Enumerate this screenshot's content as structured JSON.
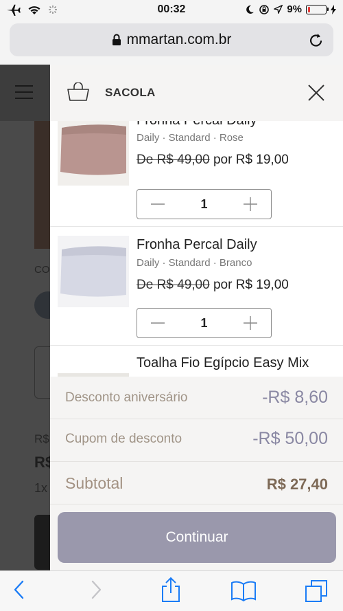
{
  "status_bar": {
    "time": "00:32",
    "battery": "9%",
    "battery_level": 0.09,
    "icons": [
      "airplane-icon",
      "wifi-icon",
      "activity-icon",
      "moon-icon",
      "rotation-lock-icon",
      "location-icon",
      "battery-icon",
      "charging-icon"
    ]
  },
  "browser": {
    "url": "mmartan.com.br",
    "icons": [
      "lock-icon",
      "reload-icon"
    ]
  },
  "background_page": {
    "partial_texts": [
      "CO",
      "R$",
      "R$",
      "1x"
    ]
  },
  "cart": {
    "title": "SACOLA",
    "items": [
      {
        "name": "Fronha Percal Daily",
        "variant": "Daily · Standard · Rose",
        "old_price": "De R$ 49,00",
        "new_price": "por R$ 19,00",
        "quantity": "1",
        "thumb_color": "#b99590"
      },
      {
        "name": "Fronha Percal Daily",
        "variant": "Daily · Standard · Branco",
        "old_price": "De R$ 49,00",
        "new_price": "por R$ 19,00",
        "quantity": "1",
        "thumb_color": "#d6d8e4"
      },
      {
        "name": "Toalha Fio Egípcio Easy Mix",
        "variant": "",
        "old_price": "",
        "new_price": "",
        "quantity": "",
        "thumb_color": "#e8e6e2"
      }
    ],
    "summary": {
      "discount_label": "Desconto aniversário",
      "discount_value": "-R$ 8,60",
      "coupon_label": "Cupom de desconto",
      "coupon_value": "-R$ 50,00",
      "subtotal_label": "Subtotal",
      "subtotal_value": "R$ 27,40"
    },
    "continue_label": "Continuar"
  },
  "toolbar": {
    "icons": [
      "back-icon",
      "forward-icon",
      "share-icon",
      "bookmarks-icon",
      "tabs-icon"
    ]
  },
  "colors": {
    "accent": "#9a98ac",
    "summary_value": "#8a88a3",
    "summary_label": "#a09487",
    "subtotal_value": "#7d6956",
    "ios_blue": "#1b7cf6"
  }
}
